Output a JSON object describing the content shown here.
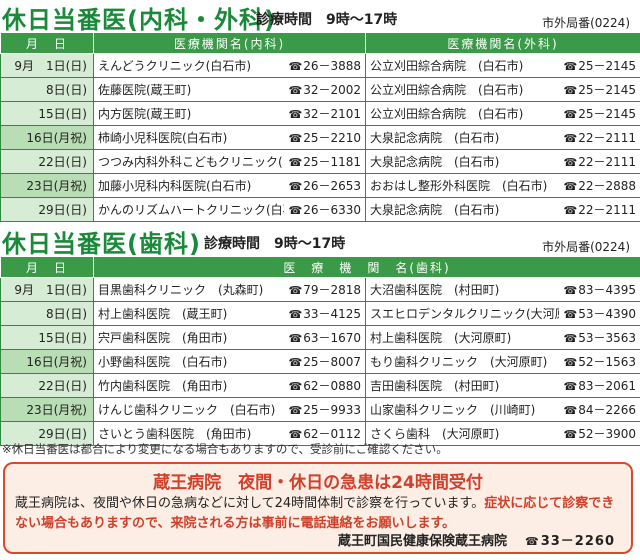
{
  "internal": {
    "title": "休日当番医(内科・外科)",
    "hours": "診療時間　9時～17時",
    "area_code": "市外局番(0224)",
    "headers": [
      "月　日",
      "医療機関名(内科)",
      "医療機関名(外科)"
    ],
    "rows": [
      {
        "date": "9月　1日(日)",
        "a_name": "えんどうクリニック(白石市)",
        "a_tel": "26－3888",
        "b_name": "公立刈田綜合病院　(白石市)",
        "b_tel": "25－2145",
        "holiday": false
      },
      {
        "date": "8日(日)",
        "a_name": "佐藤医院(蔵王町)",
        "a_tel": "32－2002",
        "b_name": "公立刈田綜合病院　(白石市)",
        "b_tel": "25－2145",
        "holiday": false
      },
      {
        "date": "15日(日)",
        "a_name": "内方医院(蔵王町)",
        "a_tel": "32－2101",
        "b_name": "公立刈田綜合病院　(白石市)",
        "b_tel": "25－2145",
        "holiday": false
      },
      {
        "date": "16日(月祝)",
        "a_name": "柿崎小児科医院(白石市)",
        "a_tel": "25－2210",
        "b_name": "大泉記念病院　(白石市)",
        "b_tel": "22－2111",
        "holiday": true
      },
      {
        "date": "22日(日)",
        "a_name": "つつみ内科外科こどもクリニック(白石市)",
        "a_tel": "25－1181",
        "b_name": "大泉記念病院　(白石市)",
        "b_tel": "22－2111",
        "holiday": false
      },
      {
        "date": "23日(月祝)",
        "a_name": "加藤小児科内科医院(白石市)",
        "a_tel": "26－2653",
        "b_name": "おおはし整形外科医院　(白石市)",
        "b_tel": "22－2888",
        "holiday": true
      },
      {
        "date": "29日(日)",
        "a_name": "かんのリズムハートクリニック(白石市)",
        "a_tel": "26－6330",
        "b_name": "大泉記念病院　(白石市)",
        "b_tel": "22－2111",
        "holiday": false
      }
    ]
  },
  "dental": {
    "title": "休日当番医(歯科)",
    "hours": "診療時間　9時～17時",
    "area_code": "市外局番(0224)",
    "headers": [
      "月　日",
      "医　療　機　関　名(歯科)"
    ],
    "rows": [
      {
        "date": "9月　1日(日)",
        "a_name": "目黒歯科クリニック　(丸森町)",
        "a_tel": "79－2818",
        "b_name": "大沼歯科医院　(村田町)",
        "b_tel": "83－4395",
        "holiday": false
      },
      {
        "date": "8日(日)",
        "a_name": "村上歯科医院　(蔵王町)",
        "a_tel": "33－4125",
        "b_name": "スエヒロデンタルクリニック(大河原町)",
        "b_tel": "53－4390",
        "holiday": false
      },
      {
        "date": "15日(日)",
        "a_name": "宍戸歯科医院　(角田市)",
        "a_tel": "63－1670",
        "b_name": "村上歯科医院　(大河原町)",
        "b_tel": "53－3563",
        "holiday": false
      },
      {
        "date": "16日(月祝)",
        "a_name": "小野歯科医院　(白石市)",
        "a_tel": "25－8007",
        "b_name": "もり歯科クリニック　(大河原町)",
        "b_tel": "52－1563",
        "holiday": true
      },
      {
        "date": "22日(日)",
        "a_name": "竹内歯科医院　(角田市)",
        "a_tel": "62－0880",
        "b_name": "吉田歯科医院　(村田町)",
        "b_tel": "83－2061",
        "holiday": false
      },
      {
        "date": "23日(月祝)",
        "a_name": "けんじ歯科クリニック　(白石市)",
        "a_tel": "25－9933",
        "b_name": "山家歯科クリニック　(川崎町)",
        "b_tel": "84－2266",
        "holiday": true
      },
      {
        "date": "29日(日)",
        "a_name": "さいとう歯科医院　(角田市)",
        "a_tel": "62－0112",
        "b_name": "さくら歯科　(大河原町)",
        "b_tel": "52－3900",
        "holiday": false
      }
    ]
  },
  "note": "※休日当番医は都合により変更になる場合もありますので、受診前にご確認ください。",
  "notice": {
    "title": "蔵王病院　夜間・休日の急患は24時間受付",
    "body_normal": "蔵王病院は、夜間や休日の急病などに対して24時間体制で診察を行っています。",
    "body_red": "症状に応じて診察できない場合もありますので、来院される方は事前に電話連絡をお願いします。",
    "footer_name": "蔵王町国民健康保険蔵王病院",
    "footer_tel": "33－2260"
  },
  "tel_icon": "telephone-icon",
  "colors": {
    "accent_green": "#3b9a47",
    "title_green": "#1a8a3a",
    "notice_red": "#d0402a"
  }
}
